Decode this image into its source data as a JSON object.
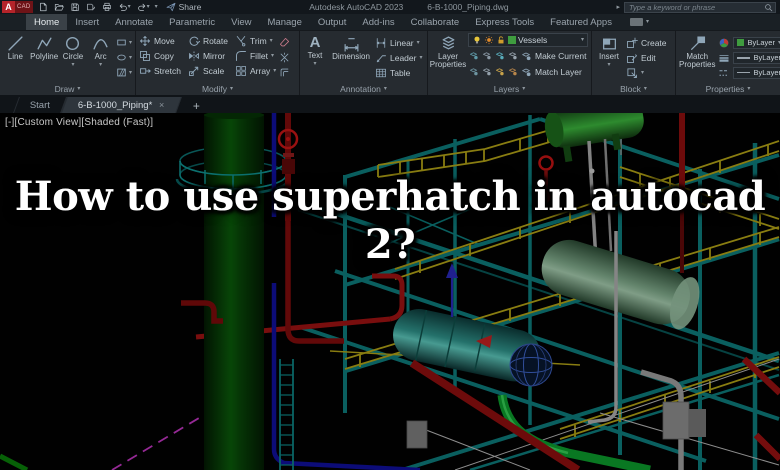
{
  "titlebar": {
    "logo_letter": "A",
    "logo_sub": "CAD",
    "share": "Share",
    "app": "Autodesk AutoCAD 2023",
    "doc": "6-B-1000_Piping.dwg",
    "search_placeholder": "Type a keyword or phrase"
  },
  "glyphs": {
    "caret": "▾",
    "close": "×",
    "play": "▸"
  },
  "ribbon": {
    "active_tab": "Home",
    "tabs": [
      "Home",
      "Insert",
      "Annotate",
      "Parametric",
      "View",
      "Manage",
      "Output",
      "Add-ins",
      "Collaborate",
      "Express Tools",
      "Featured Apps"
    ],
    "draw": {
      "label": "Draw",
      "buttons": [
        "Line",
        "Polyline",
        "Circle",
        "Arc"
      ]
    },
    "modify": {
      "label": "Modify",
      "col1": [
        "Move",
        "Copy",
        "Stretch"
      ],
      "col2": [
        "Rotate",
        "Mirror",
        "Scale"
      ],
      "col3": [
        "Trim",
        "Fillet",
        "Array"
      ]
    },
    "annotation": {
      "label": "Annotation",
      "big": [
        "Text",
        "Dimension"
      ],
      "rows": [
        "Linear",
        "Leader",
        "Table"
      ]
    },
    "layers": {
      "label": "Layers",
      "big": "Layer Properties",
      "current_layer": "Vessels",
      "rows": [
        "Make Current",
        "Match Layer"
      ]
    },
    "block": {
      "label": "Block",
      "big": "Insert",
      "rows": [
        "Create",
        "Edit"
      ]
    },
    "properties": {
      "label": "Properties",
      "big": "Match Properties",
      "color": "ByLayer",
      "lineweight": "ByLayer",
      "linetype": "ByLayer"
    }
  },
  "doc_tabs": {
    "start": "Start",
    "active": "6-B-1000_Piping*",
    "new": "+"
  },
  "viewport": {
    "controls": "[-][Custom View][Shaded (Fast)]"
  },
  "overlay": {
    "line1": "How to use superhatch in autocad",
    "line2": "2?"
  },
  "colors": {
    "logo_red": "#b5242a",
    "active_tab_bg": "#3a4147",
    "ribbon_bg": "#262b30",
    "layer_swatch_green": "#3f9c3f",
    "structure_teal": "#0d7a7a",
    "handrail_yellow": "#b0a016",
    "pipe_red": "#8c0f0f",
    "pipe_blue": "#10109a",
    "column_green": "#0a5a0a",
    "vessel_bright_green": "#2f9431",
    "vessel_sage": "#7fa98a",
    "vessel_teal": "#2f9189",
    "sphere_wireframe_blue": "#3b5cb8",
    "dashed_magenta": "#bf35bf",
    "title_text": "#ffffff"
  }
}
